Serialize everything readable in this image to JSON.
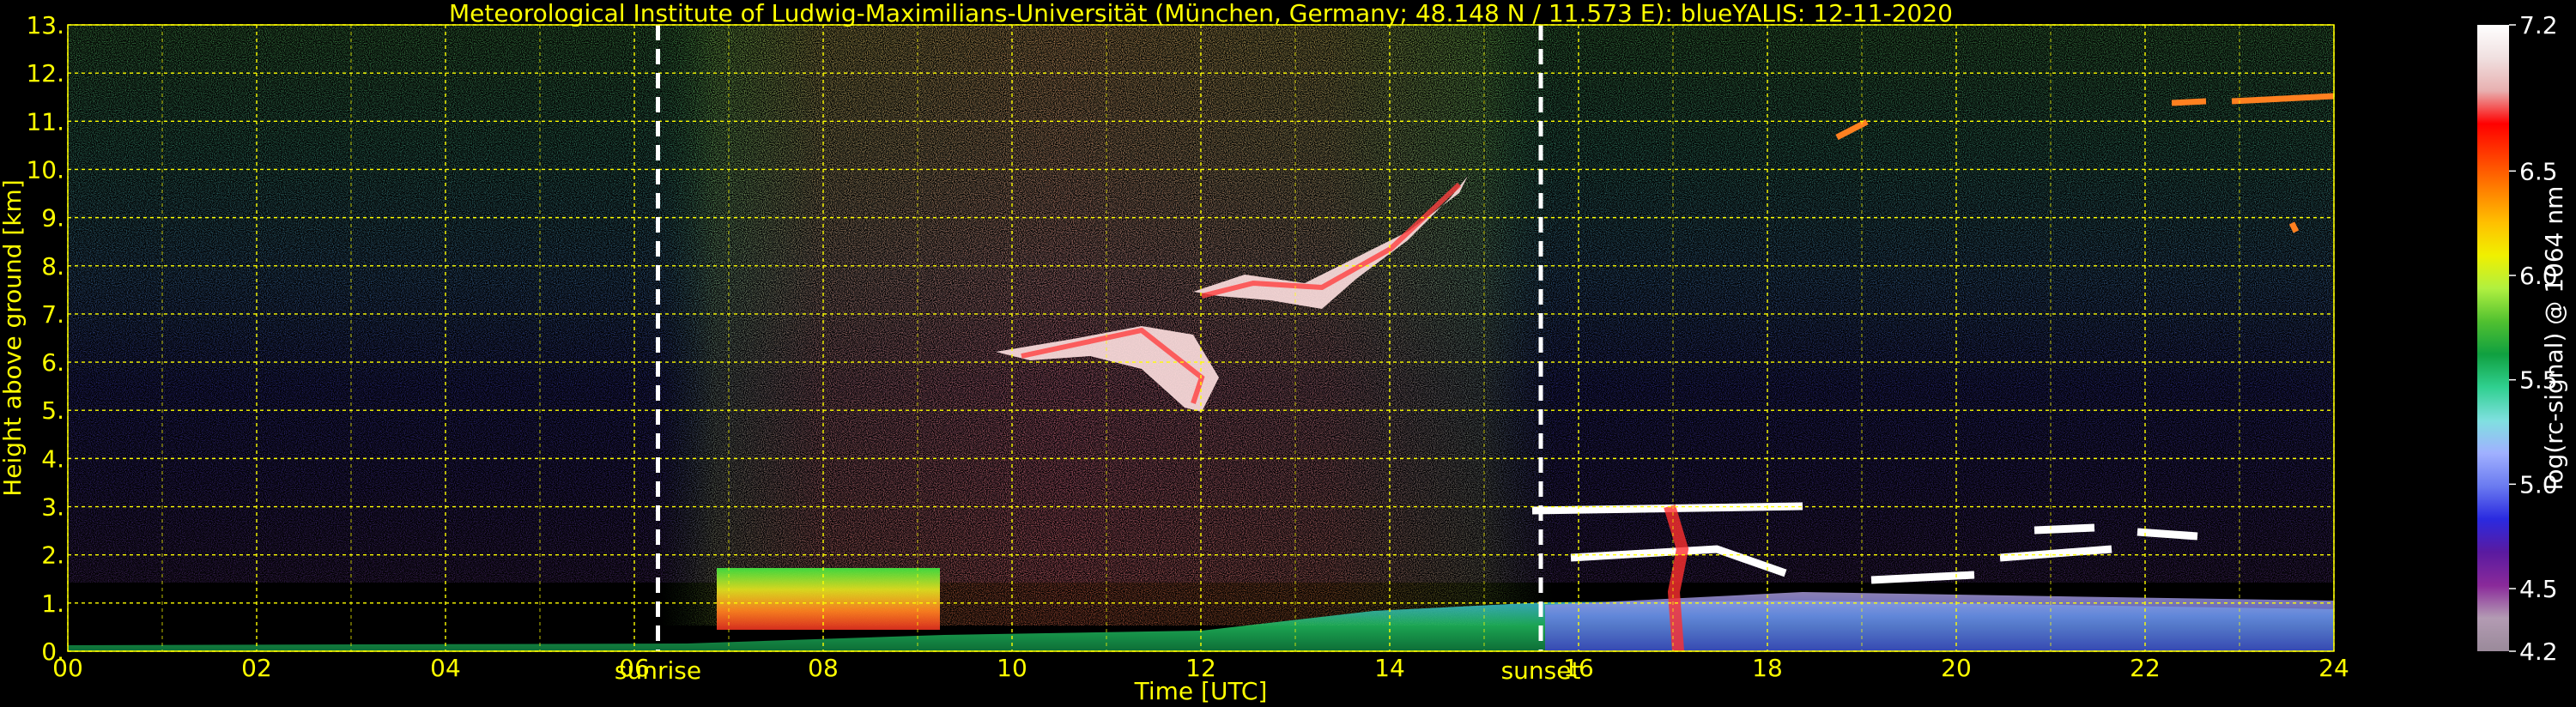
{
  "chart_data": {
    "type": "heatmap",
    "title": "Meteorological Institute of Ludwig-Maximilians-Universität (München, Germany; 48.148 N / 11.573 E):    blueYALIS: 12-11-2020",
    "xlabel": "Time [UTC]",
    "ylabel": "Height above ground [km]",
    "colorbar_label": "log(rc-signal) @ 1064 nm",
    "xlim": [
      0,
      24
    ],
    "ylim": [
      0,
      13
    ],
    "x_tick_labels": [
      "00",
      "02",
      "04",
      "06",
      "08",
      "10",
      "12",
      "14",
      "16",
      "18",
      "20",
      "22",
      "24"
    ],
    "y_tick_labels": [
      "0.",
      "1.",
      "2.",
      "3.",
      "4.",
      "5.",
      "6.",
      "7.",
      "8.",
      "9.",
      "10.",
      "11.",
      "12.",
      "13."
    ],
    "colorbar_range": [
      4.2,
      7.2
    ],
    "colorbar_tick_labels": [
      "4.2",
      "4.5",
      "5.0",
      "5.5",
      "6.0",
      "6.5",
      "7.2"
    ],
    "grid": true,
    "markers": [
      {
        "label": "sunrise",
        "time": 6.25
      },
      {
        "label": "sunset",
        "time": 15.6
      }
    ],
    "colors": {
      "text": "#ffff00",
      "grid": "#ffff00",
      "marker_line": "#ffffff",
      "colorbar_stops": [
        "#9a8a9a",
        "#b39bb3",
        "#8a2a9a",
        "#5a1aa0",
        "#2a2ae0",
        "#6a7af0",
        "#a0b0ff",
        "#80e0e0",
        "#30d090",
        "#10a040",
        "#50c030",
        "#b0f040",
        "#f0f000",
        "#ffc000",
        "#ff8000",
        "#ff4000",
        "#ff0000",
        "#e8b0b0",
        "#f0e0e0",
        "#ffffff"
      ]
    }
  }
}
